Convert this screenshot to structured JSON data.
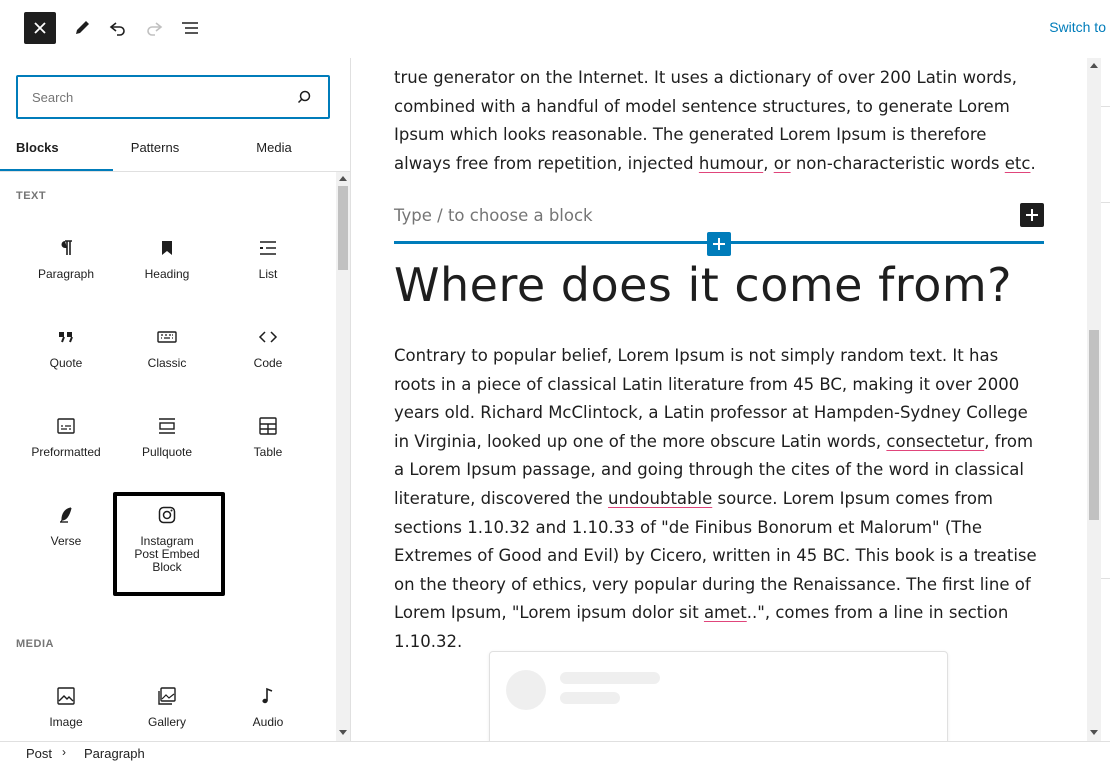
{
  "toolbar": {
    "close_icon": "close-icon",
    "edit_icon": "pencil-icon",
    "undo_icon": "undo-icon",
    "redo_icon": "redo-icon",
    "list_view_icon": "list-view-icon",
    "switch_label": "Switch to"
  },
  "sidebar": {
    "search_placeholder": "Search",
    "tabs": [
      "Blocks",
      "Patterns",
      "Media"
    ],
    "sections": [
      {
        "label": "TEXT",
        "items": [
          {
            "label": "Paragraph",
            "icon": "paragraph-icon"
          },
          {
            "label": "Heading",
            "icon": "heading-icon"
          },
          {
            "label": "List",
            "icon": "list-icon"
          },
          {
            "label": "Quote",
            "icon": "quote-icon"
          },
          {
            "label": "Classic",
            "icon": "classic-icon"
          },
          {
            "label": "Code",
            "icon": "code-icon"
          },
          {
            "label": "Preformatted",
            "icon": "preformatted-icon"
          },
          {
            "label": "Pullquote",
            "icon": "pullquote-icon"
          },
          {
            "label": "Table",
            "icon": "table-icon"
          },
          {
            "label": "Verse",
            "icon": "verse-icon"
          },
          {
            "label": "Instagram Post Embed Block",
            "icon": "instagram-icon"
          }
        ]
      },
      {
        "label": "MEDIA",
        "items": [
          {
            "label": "Image",
            "icon": "image-icon"
          },
          {
            "label": "Gallery",
            "icon": "gallery-icon"
          },
          {
            "label": "Audio",
            "icon": "audio-icon"
          }
        ]
      }
    ]
  },
  "canvas": {
    "para1_partial": "true generator on the Internet. It uses a dictionary of over 200 Latin words, combined with a handful of model sentence structures, to generate Lorem Ipsum which looks reasonable. The generated Lorem Ipsum is therefore always free from repetition, injected ",
    "para1_humour": "humour",
    "para1_mid": ", ",
    "para1_or": "or",
    "para1_rest": " non-characteristic words ",
    "para1_etc": "etc",
    "para1_end": ".",
    "block_placeholder": "Type / to choose a block",
    "heading": "Where does it come from?",
    "para2_a": "Contrary to popular belief, Lorem Ipsum is not simply random text. It has roots in a piece of classical Latin literature from 45 BC, making it over 2000 years old. Richard McClintock, a Latin professor at Hampden-Sydney College in Virginia, looked up one of the more obscure Latin words, ",
    "para2_consectetur": "consectetur",
    "para2_b": ", from a Lorem Ipsum passage, and going through the cites of the word in classical literature, discovered the ",
    "para2_undoubtable": "undoubtable",
    "para2_c": " source. Lorem Ipsum comes from sections 1.10.32 and 1.10.33 of \"de Finibus Bonorum et Malorum\" (The Extremes of Good and Evil) by Cicero, written in 45 BC. This book is a treatise on the theory of ethics, very popular during the Renaissance. The first line of Lorem Ipsum, \"Lorem ipsum dolor sit ",
    "para2_amet": "amet",
    "para2_d": "..\", comes from a line in section 1.10.32."
  },
  "breadcrumb": [
    "Post",
    "Paragraph"
  ],
  "colors": {
    "accent": "#007cba",
    "spell_underline": "#e0457b"
  }
}
